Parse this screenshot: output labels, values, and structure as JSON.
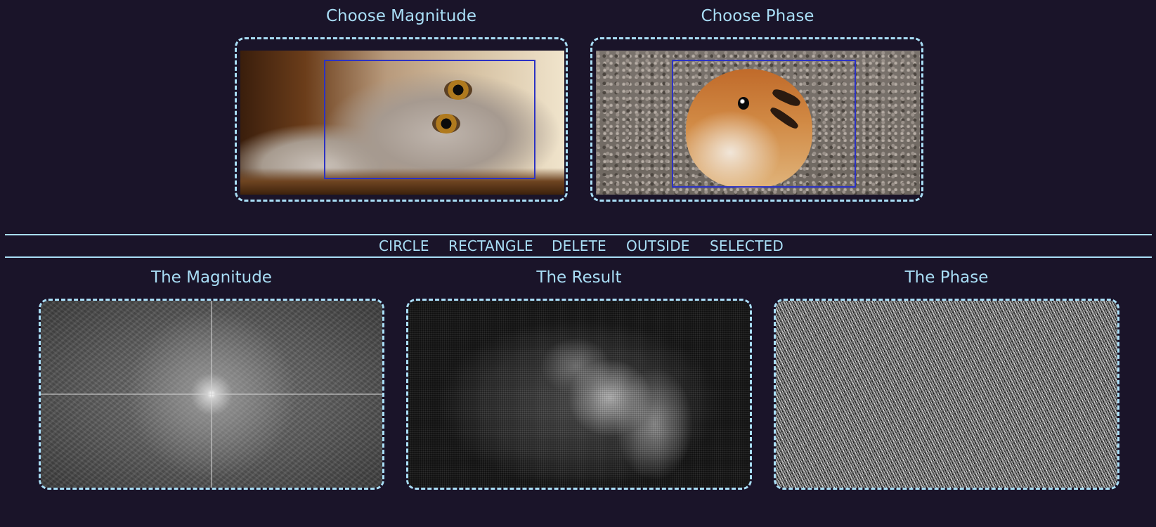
{
  "sections": {
    "choose_magnitude_title": "Choose Magnitude",
    "choose_phase_title": "Choose Phase",
    "magnitude_title": "The Magnitude",
    "result_title": "The Result",
    "phase_title": "The Phase"
  },
  "toolbar": {
    "circle_label": "CIRCLE",
    "rectangle_label": "RECTANGLE",
    "delete_label": "DELETE",
    "outside_label": "OUTSIDE",
    "selected_label": "SELECTED"
  },
  "colors": {
    "background": "#1a1429",
    "accent": "#a9def6",
    "selection": "#2c32c4"
  }
}
